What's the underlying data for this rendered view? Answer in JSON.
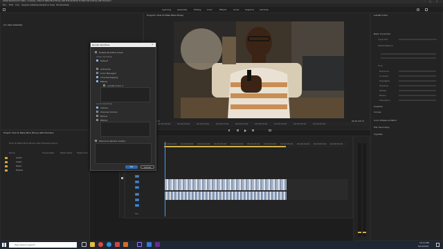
{
  "window": {
    "title": "Adobe Premiere Pro 2022 - C:\\Users\\...\\How To Make Mine Money with Premiere\\How To Make Mine Money with Premiere *"
  },
  "menu": [
    "File",
    "Edit",
    "Clip",
    "Sequence",
    "Markers",
    "Graphics",
    "View",
    "Window",
    "Help"
  ],
  "workspaces": [
    "Learning",
    "Assembly",
    "Editing",
    "Color",
    "Effects",
    "Audio",
    "Graphics",
    "Libraries"
  ],
  "source_panel": {
    "title": "(no clips selected)"
  },
  "program_panel": {
    "title": "Program: How To Make Mine Money"
  },
  "dialog": {
    "title": "Render Workflow",
    "rows": [
      {
        "label": "Enable Workflow Check",
        "checked": false
      },
      {
        "label": "Video Workflow",
        "checked": false
      },
      {
        "label": "Default",
        "checked": true
      },
      {
        "label": "Autoscale",
        "checked": false
      },
      {
        "label": "Color Managed",
        "checked": false
      },
      {
        "label": "Time Remapping",
        "checked": true
      },
      {
        "label": "Effects",
        "checked": true
      },
      {
        "label": "Lumetri Color 1",
        "checked": false
      }
    ],
    "audio_section": "Audio Workflow",
    "audio_rows": [
      {
        "label": "Volume",
        "checked": true
      },
      {
        "label": "Channel Volume",
        "checked": false
      },
      {
        "label": "Panner",
        "checked": false
      },
      {
        "label": "Effects",
        "checked": false
      }
    ],
    "render_label": "Maximum Render Quality",
    "ok": "OK",
    "cancel": "Cancel"
  },
  "project_panel": {
    "title": "Project: How To Make Mine Money with Premiere",
    "tab": "How To Make Mine Money with Premiere.prproj",
    "columns": [
      "Name",
      "Frame Rate",
      "Media Start",
      "Media End"
    ],
    "items": [
      "Audio",
      "Video",
      "Music",
      "Photos"
    ]
  },
  "timecodes": [
    "00:00:00:00",
    "00:00:05:00",
    "00:00:10:00",
    "00:00:15:00",
    "00:00:20:00",
    "00:00:25:00",
    "00:00:30:00",
    "00:00:35:00",
    "00:00:40:00",
    "00:00:45:00",
    "00:00:50:00"
  ],
  "program_timecode": "00:00:00:00",
  "program_duration": "00:01:45:17",
  "timeline": {
    "tracks_video": [
      "V3",
      "V2",
      "V1"
    ],
    "tracks_audio": [
      "A1",
      "A2",
      "A3"
    ],
    "mix": "Mix"
  },
  "right_panel": {
    "title": "Lumetri Color",
    "sections": [
      "Basic Correction",
      "Creative",
      "Curves",
      "Color Wheels & Match",
      "HSL Secondary",
      "Vignette"
    ],
    "sub": [
      "Input LUT",
      "White Balance",
      "Tone",
      "Exposure",
      "Contrast",
      "Highlights",
      "Shadows",
      "Whites",
      "Blacks",
      "Saturation"
    ]
  },
  "taskbar": {
    "search": "Type here to search",
    "time": "12:13 PM",
    "date": "8/24/2022"
  },
  "colors": {
    "accent": "#4c9bf2",
    "bg": "#1d1d1d",
    "panel": "#232323",
    "dialog": "#ececec"
  }
}
